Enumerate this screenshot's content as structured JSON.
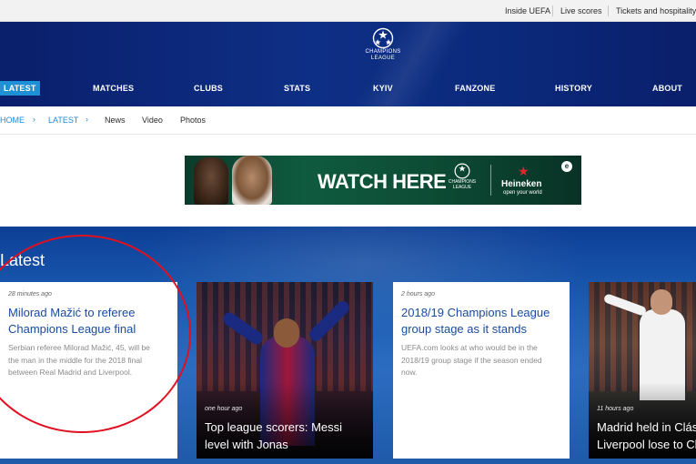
{
  "topbar": {
    "links": [
      "Inside UEFA",
      "Live scores",
      "Tickets and hospitality"
    ]
  },
  "header": {
    "logo_line1": "CHAMPIONS",
    "logo_line2": "LEAGUE",
    "nav": [
      "LATEST",
      "MATCHES",
      "CLUBS",
      "STATS",
      "KYIV",
      "FANZONE",
      "HISTORY",
      "ABOUT"
    ],
    "active_nav": "LATEST"
  },
  "breadcrumb": {
    "home": "HOME",
    "latest": "LATEST",
    "chevron": "›",
    "items": [
      "News",
      "Video",
      "Photos"
    ]
  },
  "ad": {
    "cta": "WATCH HERE",
    "logo_line1": "CHAMPIONS",
    "logo_line2": "LEAGUE",
    "sponsor": "Heineken",
    "sponsor_tagline": "open your world",
    "corner_mark": "e"
  },
  "latest": {
    "heading": "Latest",
    "cards": [
      {
        "time": "28 minutes ago",
        "title_line1": "Milorad Mažić to referee",
        "title_line2": "Champions League final",
        "desc_line1": "Serbian referee Milorad Mažić, 45, will be",
        "desc_line2": "the man in the middle for the 2018 final",
        "desc_line3": "between Real Madrid and Liverpool."
      },
      {
        "time": "one hour ago",
        "title_line1": "Top league scorers: Messi",
        "title_line2": "level with Jonas"
      },
      {
        "time": "2 hours ago",
        "title_line1": "2018/19 Champions League",
        "title_line2": "group stage as it stands",
        "desc_line1": "UEFA.com looks at who would be in the",
        "desc_line2": "2018/19 group stage if the season ended",
        "desc_line3": "now."
      },
      {
        "time": "11 hours ago",
        "title_line1": "Madrid held in Clás",
        "title_line2": "Liverpool lose to Ch"
      }
    ]
  },
  "colors": {
    "header_blue": "#0e2f86",
    "active_tab": "#1e90d6",
    "link_blue": "#1e8bd6",
    "card_title_blue": "#1a4ba0",
    "annotation_red": "#e01020"
  }
}
